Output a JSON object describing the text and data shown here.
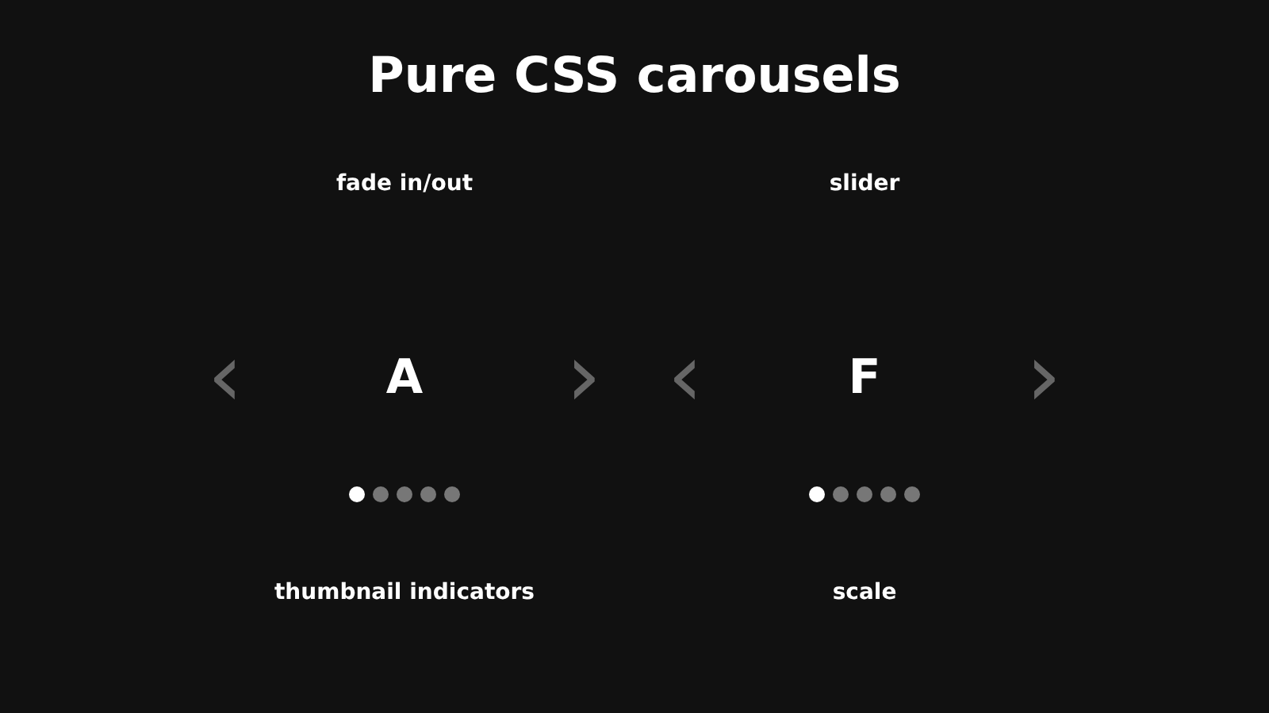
{
  "heading": "Pure CSS carousels",
  "carousels": [
    {
      "title": "fade in/out",
      "prev": "‹",
      "next": "›",
      "slide": "A",
      "indicators": [
        {
          "selected": true
        },
        {
          "selected": false
        },
        {
          "selected": false
        },
        {
          "selected": false
        },
        {
          "selected": false
        }
      ]
    },
    {
      "title": "slider",
      "prev": "‹",
      "next": "›",
      "slide": "F",
      "indicators": [
        {
          "selected": true
        },
        {
          "selected": false
        },
        {
          "selected": false
        },
        {
          "selected": false
        },
        {
          "selected": false
        }
      ]
    }
  ],
  "more_carousels": [
    {
      "title": "thumbnail indicators"
    },
    {
      "title": "scale"
    }
  ]
}
